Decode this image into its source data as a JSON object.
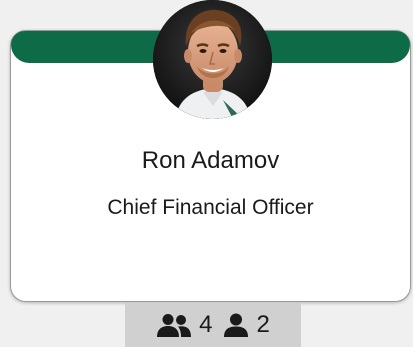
{
  "card": {
    "name": "Ron Adamov",
    "title": "Chief Financial Officer",
    "band_color": "#0e6b47",
    "avatar_icon": "portrait-photo"
  },
  "stats": {
    "team_icon": "group-icon",
    "team_count": "4",
    "direct_icon": "person-icon",
    "direct_count": "2"
  }
}
